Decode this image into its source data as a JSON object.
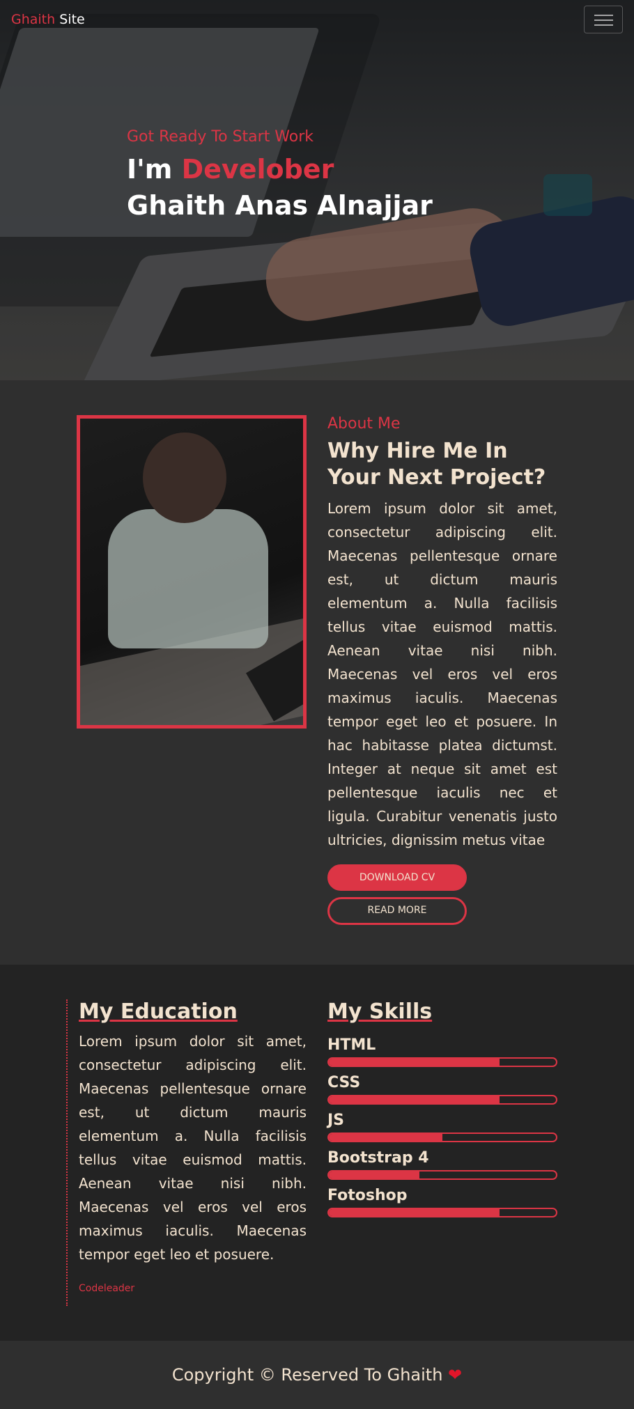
{
  "nav": {
    "brand_first": "Ghaith",
    "brand_second": " Site"
  },
  "hero": {
    "subtitle": "Got Ready To Start Work",
    "im": "I'm ",
    "role": "Develober",
    "name": "Ghaith Anas Alnajjar"
  },
  "about": {
    "label": "About Me",
    "title": "Why Hire Me In Your Next Project?",
    "body": "Lorem ipsum dolor sit amet, consectetur adipiscing elit. Maecenas pellentesque ornare est, ut dictum mauris elementum a. Nulla facilisis tellus vitae euismod mattis. Aenean vitae nisi nibh. Maecenas vel eros vel eros maximus iaculis. Maecenas tempor eget leo et posuere. In hac habitasse platea dictumst. Integer at neque sit amet est pellentesque iaculis nec et ligula. Curabitur venenatis justo ultricies, dignissim metus vitae",
    "download_label": "DOWNLOAD CV",
    "readmore_label": "READ MORE"
  },
  "education": {
    "title": "My Education",
    "body": "Lorem ipsum dolor sit amet, consectetur adipiscing elit. Maecenas pellentesque ornare est, ut dictum mauris elementum a. Nulla facilisis tellus vitae euismod mattis. Aenean vitae nisi nibh. Maecenas vel eros vel eros maximus iaculis. Maecenas tempor eget leo et posuere.",
    "link": "Codeleader"
  },
  "skills": {
    "title": "My Skills",
    "items": [
      {
        "name": "HTML",
        "level": 75
      },
      {
        "name": "CSS",
        "level": 75
      },
      {
        "name": "JS",
        "level": 50
      },
      {
        "name": "Bootstrap 4",
        "level": 40
      },
      {
        "name": "Fotoshop",
        "level": 75
      }
    ]
  },
  "footer": {
    "text": "Copyright © Reserved To Ghaith ",
    "heart": "❤"
  },
  "colors": {
    "accent": "#dc3545",
    "text": "#f3e3cf",
    "bg_dark": "#232323",
    "bg": "#2f2f2f"
  }
}
